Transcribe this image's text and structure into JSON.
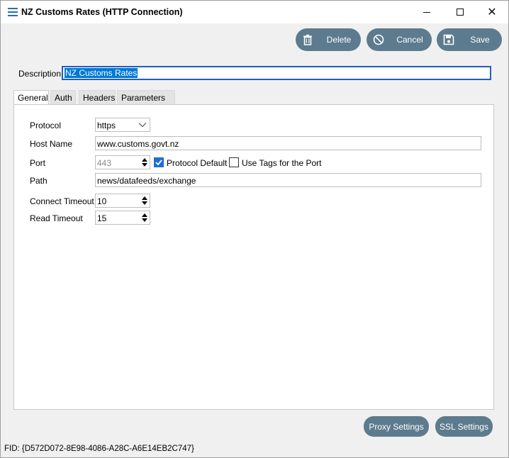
{
  "window": {
    "title": "NZ Customs Rates (HTTP Connection)",
    "close_glyph": "✕"
  },
  "toolbar": {
    "delete_label": "Delete",
    "cancel_label": "Cancel",
    "save_label": "Save"
  },
  "description": {
    "label": "Description",
    "value": "NZ Customs Rates"
  },
  "tabs": [
    {
      "label": "General"
    },
    {
      "label": "Auth"
    },
    {
      "label": "Headers"
    },
    {
      "label": "Parameters"
    }
  ],
  "general": {
    "protocol": {
      "label": "Protocol",
      "value": "https"
    },
    "host_name": {
      "label": "Host Name",
      "value": "www.customs.govt.nz"
    },
    "port": {
      "label": "Port",
      "value": "443",
      "protocol_default_label": "Protocol Default",
      "protocol_default_checked": true,
      "use_tags_label": "Use Tags for the Port",
      "use_tags_checked": false
    },
    "path": {
      "label": "Path",
      "value": "news/datafeeds/exchange"
    },
    "connect_timeout": {
      "label": "Connect Timeout",
      "value": "10"
    },
    "read_timeout": {
      "label": "Read Timeout",
      "value": "15"
    }
  },
  "footer_buttons": {
    "proxy_label": "Proxy Settings",
    "ssl_label": "SSL Settings"
  },
  "status": {
    "fid": "FID: {D572D072-8E98-4086-A28C-A6E14EB2C747}"
  },
  "colors": {
    "button_bg": "#5d7b8e",
    "accent": "#1f6fd1"
  }
}
